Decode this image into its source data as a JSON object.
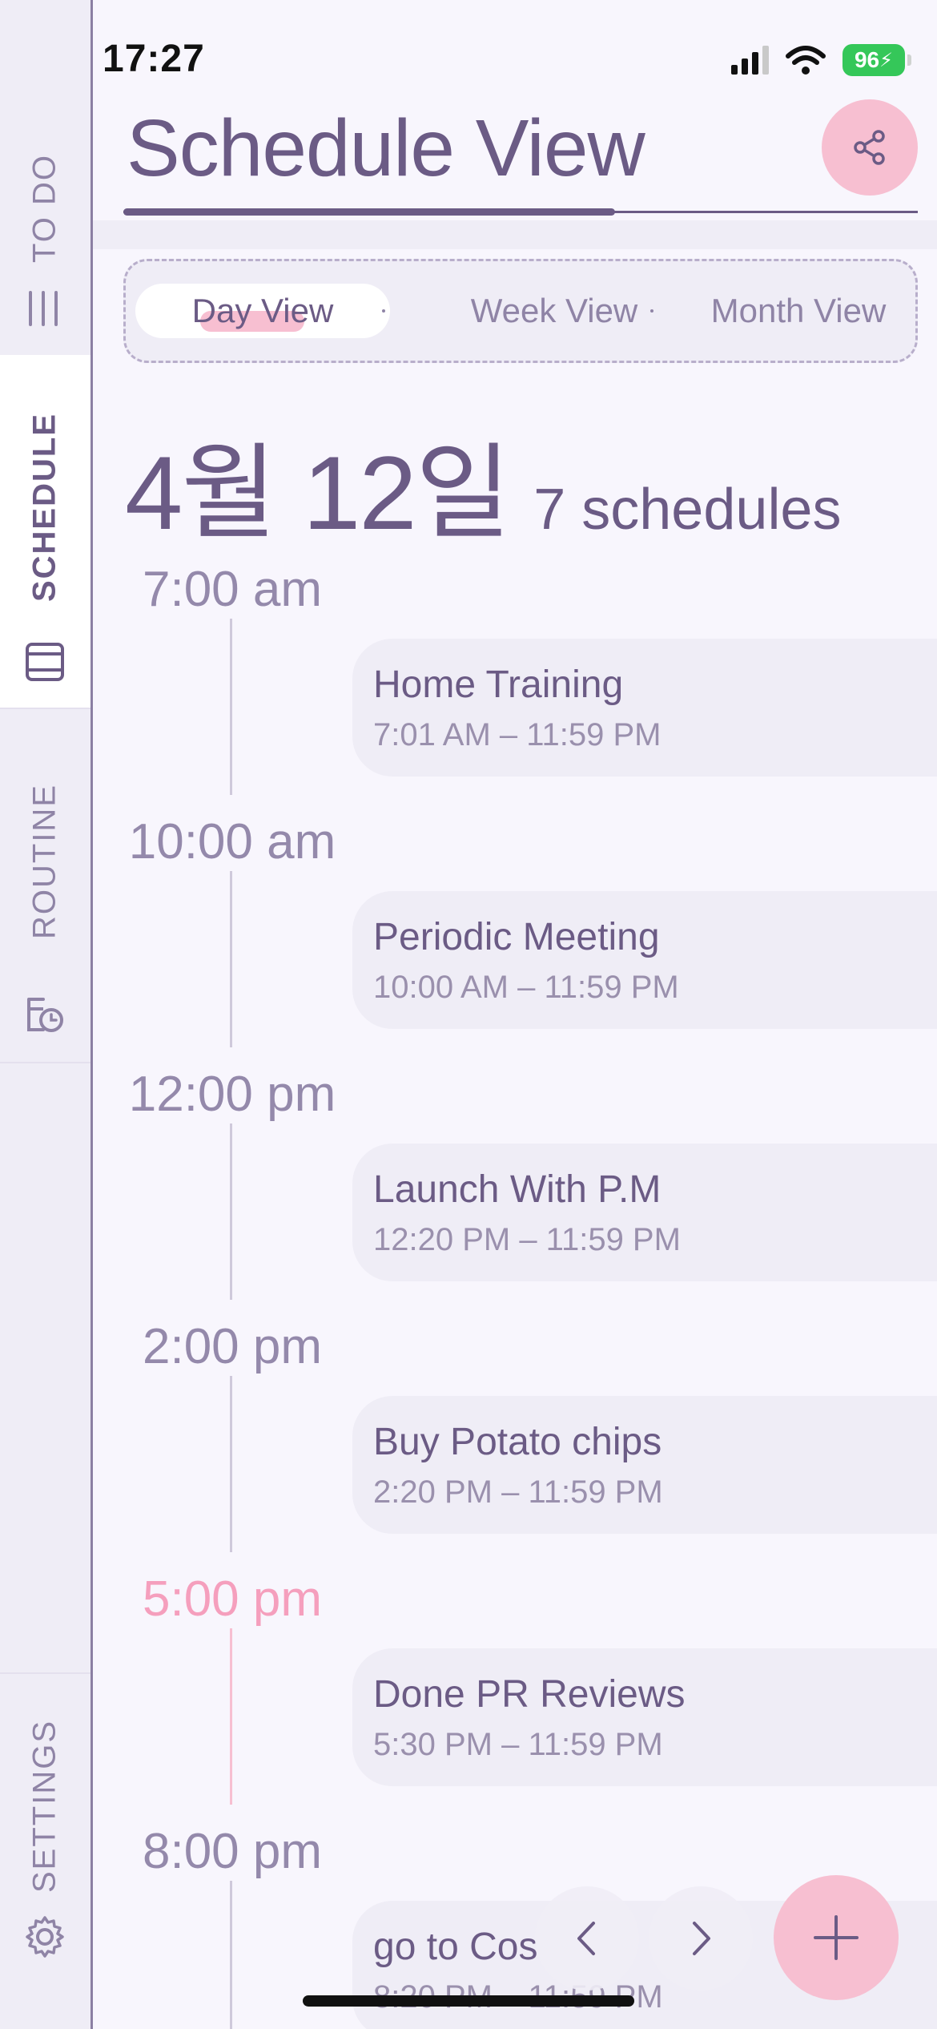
{
  "status_bar": {
    "time": "17:27",
    "battery": "96"
  },
  "sidebar": {
    "items": [
      {
        "label": "TO DO",
        "icon": "list-icon"
      },
      {
        "label": "SCHEDULE",
        "icon": "planner-icon",
        "active": true
      },
      {
        "label": "ROUTINE",
        "icon": "calendar-clock-icon"
      },
      {
        "label": "SETTINGS",
        "icon": "gear-icon"
      }
    ]
  },
  "header": {
    "title": "Schedule View",
    "share_icon": "share-icon"
  },
  "view_tabs": {
    "selected": "Day View",
    "tabs": [
      "Day View",
      "Week View",
      "Month View"
    ]
  },
  "day": {
    "date": "4월 12일",
    "count": "7 schedules"
  },
  "timeline": [
    {
      "time": "7:00 am",
      "title": "Home Training",
      "range": "7:01 AM – 11:59 PM"
    },
    {
      "time": "10:00 am",
      "title": " Periodic Meeting",
      "range": "10:00 AM – 11:59 PM"
    },
    {
      "time": "12:00 pm",
      "title": "Launch With P.M",
      "range": "12:20 PM – 11:59 PM"
    },
    {
      "time": "2:00 pm",
      "title": "Buy Potato chips",
      "range": "2:20 PM – 11:59 PM"
    },
    {
      "time": "5:00 pm",
      "title": "Done PR Reviews",
      "range": "5:30 PM – 11:59 PM",
      "current": true
    },
    {
      "time": "8:00 pm",
      "title": "go to Cos",
      "range": "8:20 PM – 11:59 PM"
    }
  ],
  "colors": {
    "primary": "#6b5b85",
    "accent_pink": "#f7bfd1",
    "current_time": "#f59fbd",
    "card_bg": "#efedf6",
    "page_bg": "#f8f6fd"
  },
  "controls": {
    "prev_icon": "chevron-left-icon",
    "next_icon": "chevron-right-icon",
    "add_icon": "plus-icon"
  }
}
